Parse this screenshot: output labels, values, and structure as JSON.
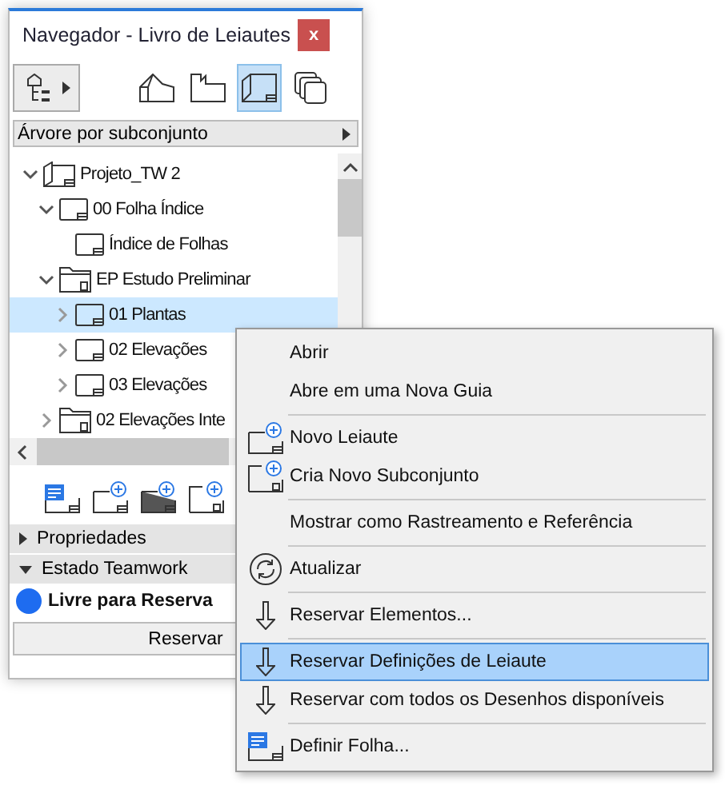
{
  "window": {
    "title": "Navegador - Livro de Leiautes",
    "close_label": "x"
  },
  "view_buttons": [
    {
      "kind": "project",
      "selected": false
    },
    {
      "kind": "views",
      "selected": false
    },
    {
      "kind": "layouts",
      "selected": true
    },
    {
      "kind": "publisher",
      "selected": false
    }
  ],
  "view_selector": {
    "label": "Árvore por subconjunto"
  },
  "tree": [
    {
      "label": "Projeto_TW 2",
      "kind": "project",
      "expanded": true,
      "selected": false,
      "children": [
        {
          "label": "00 Folha Índice",
          "kind": "layout",
          "expanded": true,
          "selected": false,
          "children": [
            {
              "label": "Índice de Folhas",
              "kind": "layout",
              "selected": false
            }
          ]
        },
        {
          "label": "EP Estudo Preliminar",
          "kind": "subset",
          "expanded": true,
          "selected": false,
          "children": [
            {
              "label": "01 Plantas",
              "kind": "layout",
              "expanded": false,
              "selected": true
            },
            {
              "label": "02 Elevações",
              "kind": "layout",
              "expanded": false,
              "selected": false
            },
            {
              "label": "03 Elevações",
              "kind": "layout",
              "expanded": false,
              "selected": false
            }
          ]
        },
        {
          "label": "02 Elevações Inte",
          "kind": "subset",
          "expanded": false,
          "selected": false
        }
      ]
    }
  ],
  "sections": [
    {
      "label": "Propriedades",
      "expanded": false
    },
    {
      "label": "Estado Teamwork",
      "expanded": true
    }
  ],
  "status": {
    "label": "Livre para Reserva"
  },
  "button": "Reservar",
  "context_menu": [
    {
      "label": "Abrir",
      "kind": "plain",
      "separator_before": false,
      "selected": false
    },
    {
      "label": "Abre em uma Nova Guia",
      "kind": "plain",
      "separator_before": false,
      "selected": false
    },
    {
      "label": "Novo Leiaute",
      "kind": "new-layout",
      "separator_before": true,
      "selected": false
    },
    {
      "label": "Cria Novo Subconjunto",
      "kind": "new-subset",
      "separator_before": false,
      "selected": false
    },
    {
      "label": "Mostrar como Rastreamento e Referência",
      "kind": "plain",
      "separator_before": true,
      "selected": false
    },
    {
      "label": "Atualizar",
      "kind": "refresh",
      "separator_before": true,
      "selected": false
    },
    {
      "label": "Reservar Elementos...",
      "kind": "reserve",
      "separator_before": true,
      "selected": false
    },
    {
      "label": "Reservar Definições de Leiaute",
      "kind": "reserve",
      "separator_before": true,
      "selected": true
    },
    {
      "label": "Reservar com todos os Desenhos disponíveis",
      "kind": "reserve",
      "separator_before": false,
      "selected": false
    },
    {
      "label": "Definir Folha...",
      "kind": "sheet",
      "separator_before": true,
      "selected": false
    }
  ]
}
